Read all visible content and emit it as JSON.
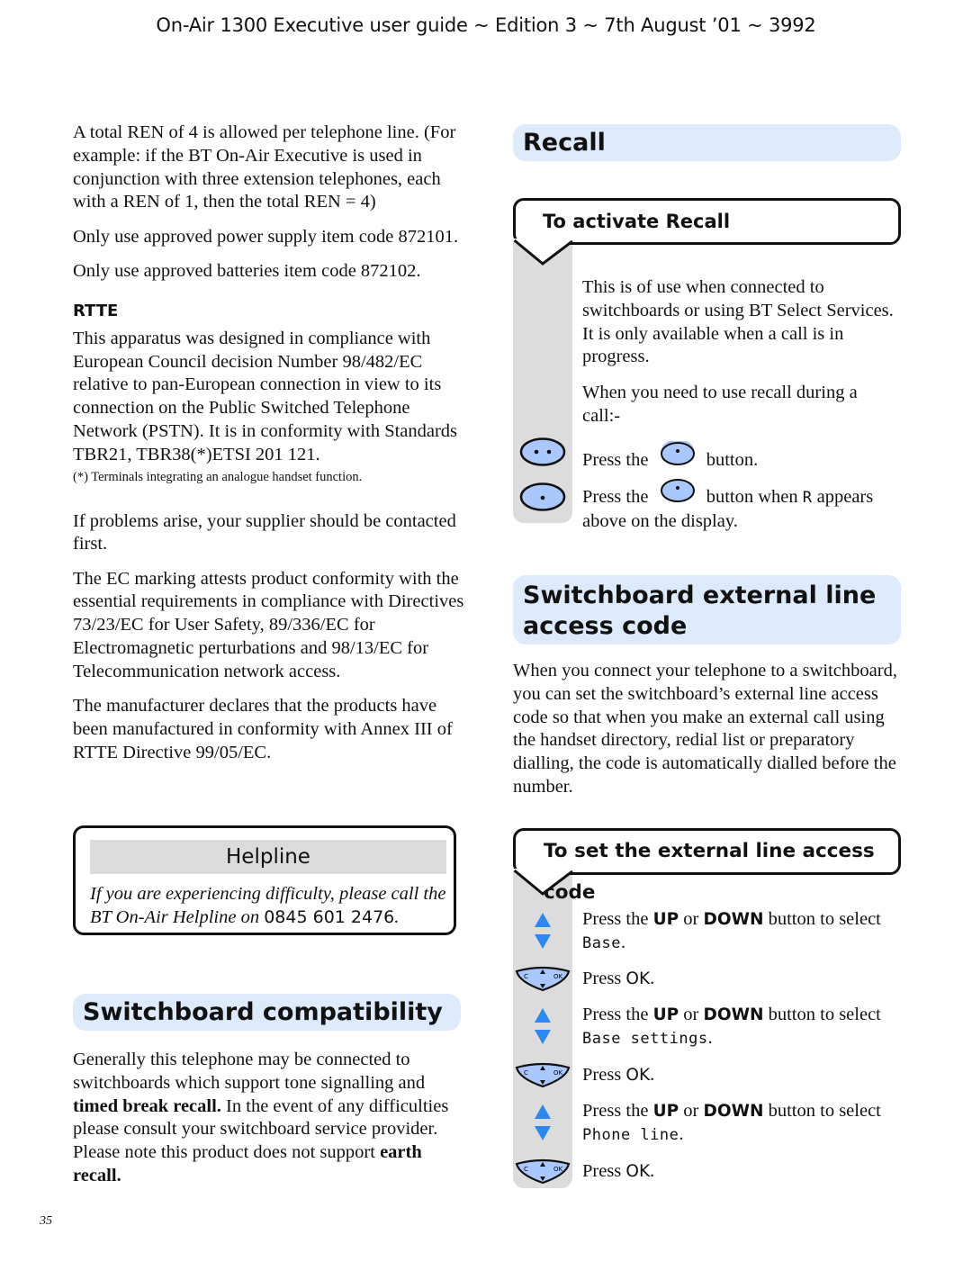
{
  "header": {
    "title": "On-Air 1300 Executive user guide ~ Edition 3 ~ 7th August ’01 ~ 3992"
  },
  "left_column": {
    "paragraphs": [
      "A total REN of 4 is allowed per telephone line. (For example: if the BT On-Air Executive is used in conjunction with three extension telephones, each with a REN of 1, then the total REN = 4)",
      "Only use approved power supply item code 872101.",
      "Only use approved batteries item code 872102."
    ],
    "rtte": {
      "heading": "RTTE",
      "paragraph": "This apparatus was designed in compliance with European Council decision Number 98/482/EC relative to pan-European connection in view to its connection on the Public Switched Telephone Network (PSTN). It is in conformity with Standards TBR21, TBR38(*)ETSI 201 121.",
      "footnote": "(*) Terminals integrating an analogue handset function."
    },
    "more_paragraphs": [
      "If problems arise, your supplier should be contacted first.",
      "The EC marking attests product conformity with the essential requirements in compliance with Directives 73/23/EC for User Safety, 89/336/EC for Electromagnetic perturbations and 98/13/EC for Telecommunication network access.",
      "The manufacturer declares that the products have been manufactured in conformity with Annex III of RTTE Directive 99/05/EC."
    ]
  },
  "helpline": {
    "title": "Helpline",
    "text": "If you are experiencing difficulty, please call the BT On-Air Helpline on",
    "number": "0845 601 2476",
    "end": "."
  },
  "switchboard_compatibility": {
    "heading": "Switchboard compatibility",
    "text_1": "Generally this telephone may be connected to switchboards which support tone signalling and",
    "bold_1": "timed break recall.",
    "text_2": " In the event of any difficulties please consult your switchboard service provider. Please note this product does not support ",
    "bold_2": "earth recall."
  },
  "recall": {
    "heading": "Recall",
    "procedure_title": "To activate Recall",
    "intro": "This is of use when connected to switchboards or using BT Select Services. It is only available when a call is in progress.",
    "when": "When you need to use recall during a call:-",
    "steps": [
      {
        "icon": "two-dot-button-icon",
        "pre": "Press the",
        "post": "button."
      },
      {
        "icon": "one-dot-button-icon",
        "pre": "Press the",
        "post": "button when",
        "display_char": "R",
        "post2": "appears above on the display."
      }
    ]
  },
  "external_line": {
    "heading_line1": "Switchboard external line",
    "heading_line2": "access code",
    "paragraph": "When you connect your telephone to a switchboard, you can set the switchboard’s external line access code so that when you make an external call using the handset directory, redial list or preparatory dialling, the code is automatically dialled before the number.",
    "procedure_title": "To set the external line access code",
    "steps": [
      {
        "icon": "up-down-arrows-icon",
        "pre": "Press the",
        "up": "UP",
        "or": "or",
        "down": "DOWN",
        "post": "button to select",
        "display": "Base",
        "end": "."
      },
      {
        "icon": "navigation-ok-button-icon",
        "pre": "Press",
        "ok": "OK",
        "end": "."
      },
      {
        "icon": "up-down-arrows-icon",
        "pre": "Press the",
        "up": "UP",
        "or": "or",
        "down": "DOWN",
        "post": "button to select",
        "display": "Base settings",
        "end": "."
      },
      {
        "icon": "navigation-ok-button-icon",
        "pre": "Press",
        "ok": "OK",
        "end": "."
      },
      {
        "icon": "up-down-arrows-icon",
        "pre": "Press the",
        "up": "UP",
        "or": "or",
        "down": "DOWN",
        "post": "button to select",
        "display": "Phone line",
        "end": "."
      },
      {
        "icon": "navigation-ok-button-icon",
        "pre": "Press",
        "ok": "OK",
        "end": "."
      }
    ],
    "nav_labels": {
      "c": "C",
      "ok": "OK"
    }
  },
  "colors": {
    "section_band": "#dceafc",
    "procedure_panel": "#dcdcdc",
    "button_blue": "#a8c8ff",
    "arrow_blue": "#2a88f0"
  },
  "page_number": "35"
}
